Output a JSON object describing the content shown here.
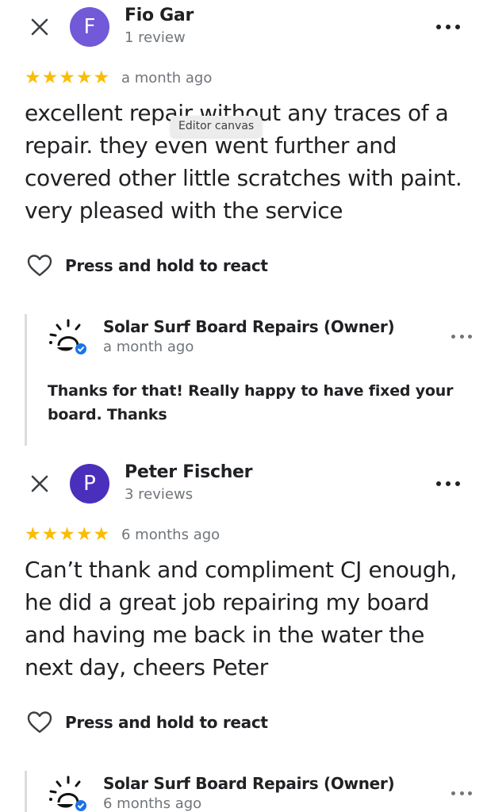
{
  "colors": {
    "star": "#fbbc04",
    "avatar_fio": "#7159d8",
    "avatar_peter": "#4a2fbd",
    "verified": "#1a73e8",
    "muted_text": "#70757a"
  },
  "tooltip": {
    "label": "Editor canvas"
  },
  "reviews": [
    {
      "close_icon": "close-icon",
      "avatar_letter": "F",
      "author": "Fio Gar",
      "author_meta": "1 review",
      "rating": 5,
      "time_ago": "a month ago",
      "text": "excellent repair without any traces of a repair. they even went further and covered other little scratches with paint. very pleased with the service",
      "react_label": "Press and hold to react",
      "owner_reply": {
        "name": "Solar Surf Board Repairs (Owner)",
        "time_ago": "a month ago",
        "text": "Thanks for that! Really happy to have fixed your board. Thanks"
      }
    },
    {
      "close_icon": "close-icon",
      "avatar_letter": "P",
      "author": "Peter Fischer",
      "author_meta": "3 reviews",
      "rating": 5,
      "time_ago": "6 months ago",
      "text": "Can’t thank and compliment CJ enough, he did a great job repairing my board and having me back in the water the next day, cheers Peter",
      "react_label": "Press and hold to react",
      "owner_reply": {
        "name": "Solar Surf Board Repairs (Owner)",
        "time_ago": "6 months ago"
      }
    }
  ]
}
